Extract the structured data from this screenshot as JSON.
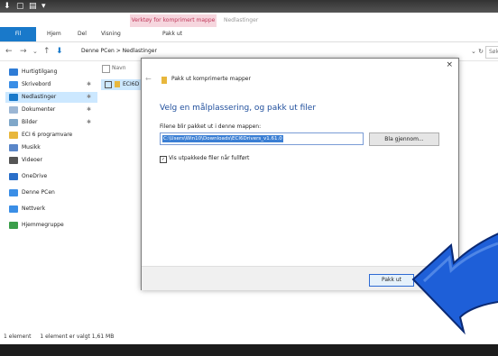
{
  "ribbon": {
    "tabs": [
      "Fil",
      "Hjem",
      "Del",
      "Visning",
      "Pakk ut"
    ],
    "context_group": "Verktøy for komprimert mappe",
    "window_title": "Nedlastinger"
  },
  "address": {
    "path": "Denne PCen  >  Nedlastinger",
    "search_placeholder": "Søk"
  },
  "sidebar": {
    "items": [
      {
        "label": "Hurtigtilgang",
        "icon": "star-icon",
        "pinned": false
      },
      {
        "label": "Skrivebord",
        "icon": "desktop-icon",
        "pinned": true
      },
      {
        "label": "Nedlastinger",
        "icon": "download-icon",
        "pinned": true
      },
      {
        "label": "Dokumenter",
        "icon": "documents-icon",
        "pinned": true
      },
      {
        "label": "Bilder",
        "icon": "pictures-icon",
        "pinned": true
      },
      {
        "label": "ECI 6 programvare",
        "icon": "folder-icon",
        "pinned": false
      },
      {
        "label": "Musikk",
        "icon": "music-icon",
        "pinned": false
      },
      {
        "label": "Videoer",
        "icon": "videos-icon",
        "pinned": false
      },
      {
        "label": "OneDrive",
        "icon": "cloud-icon",
        "pinned": false
      },
      {
        "label": "Denne PCen",
        "icon": "computer-icon",
        "pinned": false
      },
      {
        "label": "Nettverk",
        "icon": "network-icon",
        "pinned": false
      },
      {
        "label": "Hjemmegruppe",
        "icon": "homegroup-icon",
        "pinned": false
      }
    ]
  },
  "filelist": {
    "column_name": "Navn",
    "row_label": "ECI6D"
  },
  "status": {
    "count": "1 element",
    "selected": "1 element er valgt  1,61 MB"
  },
  "dialog": {
    "title": "Pakk ut komprimerte mapper",
    "heading": "Velg en målplassering, og pakk ut filer",
    "label": "Filene blir pakket ut i denne mappen:",
    "path_value": "C:\\Users\\Win10\\Downloads\\ECI6Drivers_v1.61.0",
    "browse_label": "Bla gjennom...",
    "checkbox_label": "Vis utpakkede filer når fullført",
    "checkbox_checked": true,
    "extract_label": "Pakk ut",
    "close_glyph": "×"
  },
  "colors": {
    "accent": "#1979ca",
    "arrow": "#1e5fd8",
    "context_pink": "#f6d6de",
    "selection": "#cce8ff"
  }
}
